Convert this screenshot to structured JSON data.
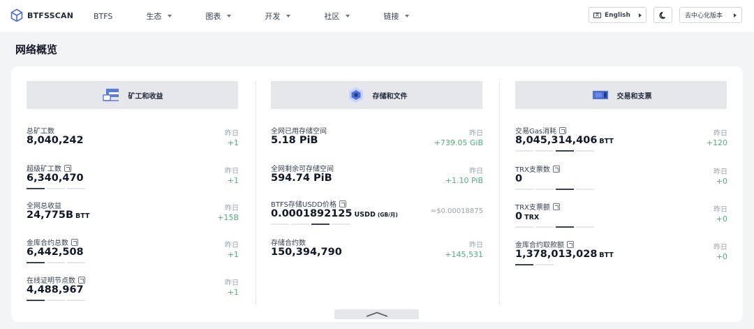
{
  "brand": {
    "name": "BTFSSCAN"
  },
  "nav": [
    {
      "label": "BTFS",
      "dropdown": false
    },
    {
      "label": "生态",
      "dropdown": true
    },
    {
      "label": "图表",
      "dropdown": true
    },
    {
      "label": "开发",
      "dropdown": true
    },
    {
      "label": "社区",
      "dropdown": true
    },
    {
      "label": "链接",
      "dropdown": true
    }
  ],
  "controls": {
    "language": "English",
    "decentralized": "去中心化版本"
  },
  "page": {
    "title": "网络概览"
  },
  "columns": [
    {
      "title": "矿工和收益",
      "stats": [
        {
          "label": "总矿工数",
          "value": "8,040,242",
          "unit": "",
          "yesterday": "昨日",
          "delta": "+1",
          "info": false,
          "bars": []
        },
        {
          "label": "超级矿工数",
          "value": "6,340,470",
          "unit": "",
          "yesterday": "昨日",
          "delta": "+1",
          "info": true,
          "bars": [
            1,
            0,
            0
          ]
        },
        {
          "label": "全网总收益",
          "value": "24,775B",
          "unit": "BTT",
          "yesterday": "昨日",
          "delta": "+15B",
          "info": false,
          "bars": []
        },
        {
          "label": "金库合约总数",
          "value": "6,442,508",
          "unit": "",
          "yesterday": "昨日",
          "delta": "+1",
          "info": true,
          "bars": [
            1,
            0,
            0
          ]
        },
        {
          "label": "在线证明节点数",
          "value": "4,488,967",
          "unit": "",
          "yesterday": "昨日",
          "delta": "+1",
          "info": true,
          "bars": [
            1,
            0,
            0
          ]
        }
      ]
    },
    {
      "title": "存储和文件",
      "stats": [
        {
          "label": "全网已用存储空间",
          "value": "5.18 PiB",
          "unit": "",
          "yesterday": "昨日",
          "delta": "+739.05 GiB",
          "info": false,
          "bars": []
        },
        {
          "label": "全网剩余可存储空间",
          "value": "594.74 PiB",
          "unit": "",
          "yesterday": "昨日",
          "delta": "+1.10 PiB",
          "info": false,
          "bars": []
        },
        {
          "label": "BTFS存储USDD价格",
          "value": "0.0001892125",
          "unit": "USDD",
          "unit2": "(GB/月)",
          "yesterday": "",
          "delta": "≈$0.00018875",
          "info": true,
          "bars": [
            0,
            0,
            1,
            0
          ]
        },
        {
          "label": "存储合约数",
          "value": "150,394,790",
          "unit": "",
          "yesterday": "昨日",
          "delta": "+145,531",
          "info": false,
          "bars": []
        }
      ]
    },
    {
      "title": "交易和支票",
      "stats": [
        {
          "label": "交易Gas消耗",
          "value": "8,045,314,406",
          "unit": "BTT",
          "yesterday": "昨日",
          "delta": "+120",
          "info": true,
          "bars": [
            0,
            0,
            1,
            0
          ]
        },
        {
          "label": "TRX支票数",
          "value": "0",
          "unit": "",
          "yesterday": "昨日",
          "delta": "+0",
          "info": true,
          "bars": [
            0,
            0,
            1,
            0
          ]
        },
        {
          "label": "TRX支票额",
          "value": "0",
          "unit": "TRX",
          "yesterday": "昨日",
          "delta": "+0",
          "info": true,
          "bars": [
            0,
            0,
            1,
            0
          ]
        },
        {
          "label": "金库合约取款额",
          "value": "1,378,013,028",
          "unit": "BTT",
          "yesterday": "昨日",
          "delta": "+0",
          "info": true,
          "bars": [
            1,
            0
          ]
        }
      ]
    }
  ]
}
